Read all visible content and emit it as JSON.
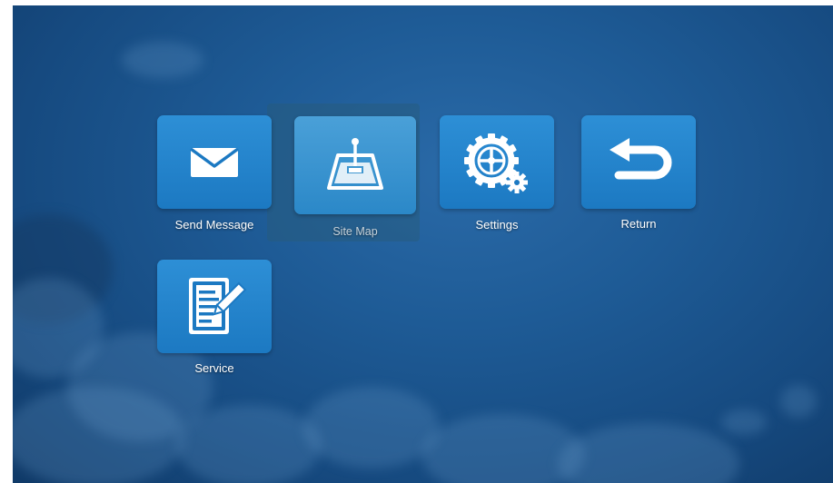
{
  "menu": {
    "items": [
      {
        "label": "Send Message",
        "icon": "envelope-icon"
      },
      {
        "label": "Site Map",
        "icon": "satellite-dish-icon",
        "focused": true
      },
      {
        "label": "Settings",
        "icon": "gear-icon"
      },
      {
        "label": "Return",
        "icon": "return-arrow-icon"
      },
      {
        "label": "Service",
        "icon": "document-edit-icon"
      }
    ]
  },
  "colors": {
    "background": "#1e5b96",
    "tile": "#1c79c2",
    "tile_focused": "#3f96d0",
    "text": "#ffffff"
  }
}
